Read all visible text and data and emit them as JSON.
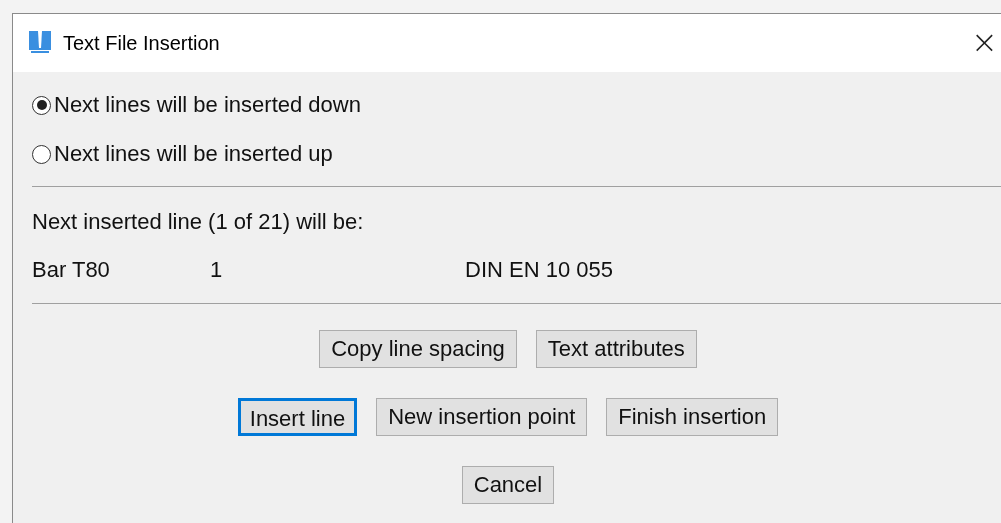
{
  "window": {
    "title": "Text File Insertion",
    "close": "×"
  },
  "direction_options": [
    {
      "label": "Next lines will be inserted down",
      "selected": true
    },
    {
      "label": "Next lines will be inserted up",
      "selected": false
    }
  ],
  "next_line": {
    "label": "Next inserted line (1 of 21) will be:",
    "cells": [
      "Bar T80",
      "1",
      "DIN EN 10 055"
    ]
  },
  "button_rows": [
    [
      {
        "label": "Copy line spacing",
        "focused": false
      },
      {
        "label": "Text attributes",
        "focused": false
      }
    ],
    [
      {
        "label": "Insert line",
        "focused": true
      },
      {
        "label": "New insertion point",
        "focused": false
      },
      {
        "label": "Finish insertion",
        "focused": false
      }
    ],
    [
      {
        "label": "Cancel",
        "focused": false
      }
    ]
  ]
}
